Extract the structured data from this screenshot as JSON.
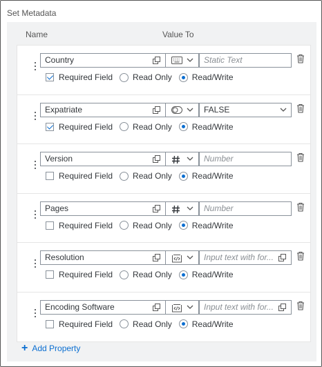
{
  "header": {
    "title": "Set Metadata"
  },
  "columns": {
    "name": "Name",
    "value": "Value To"
  },
  "options": {
    "required": "Required Field",
    "read_only": "Read Only",
    "read_write": "Read/Write"
  },
  "rows": [
    {
      "name": "Country",
      "type_icon": "keyboard-icon",
      "value": "Static Text",
      "value_is_placeholder": true,
      "value_control": "none",
      "required": true,
      "access": "read_write"
    },
    {
      "name": "Expatriate",
      "type_icon": "toggle-icon",
      "value": "FALSE",
      "value_is_placeholder": false,
      "value_control": "dropdown",
      "required": true,
      "access": "read_write"
    },
    {
      "name": "Version",
      "type_icon": "hash-icon",
      "value": "Number",
      "value_is_placeholder": true,
      "value_control": "none",
      "required": false,
      "access": "read_write"
    },
    {
      "name": "Pages",
      "type_icon": "hash-icon",
      "value": "Number",
      "value_is_placeholder": true,
      "value_control": "none",
      "required": false,
      "access": "read_write"
    },
    {
      "name": "Resolution",
      "type_icon": "code-tag-icon",
      "value": "Input text with for...",
      "value_is_placeholder": true,
      "value_control": "copy",
      "required": false,
      "access": "read_write"
    },
    {
      "name": "Encoding Software",
      "type_icon": "code-tag-icon",
      "value": "Input text with for...",
      "value_is_placeholder": true,
      "value_control": "copy",
      "required": false,
      "access": "read_write"
    }
  ],
  "footer": {
    "add_label": "Add Property"
  },
  "colors": {
    "accent": "#0a6ed1",
    "panel_bg": "#f1f2f3",
    "border": "#89919a"
  }
}
